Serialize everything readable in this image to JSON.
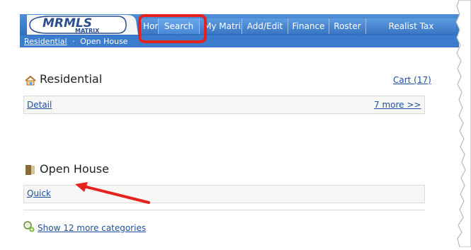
{
  "header": {
    "logo_text": "MRMLS",
    "logo_subtext": "MATRIX",
    "tabs": [
      {
        "label": "Home"
      },
      {
        "label": "Search"
      },
      {
        "label": "My Matrix"
      },
      {
        "label": "Add/Edit"
      },
      {
        "label": "Finance"
      },
      {
        "label": "Roster"
      },
      {
        "label": "Realist Tax"
      }
    ],
    "active_tab": "Search"
  },
  "breadcrumb": {
    "link": "Residential",
    "separator": "·",
    "current": "Open House"
  },
  "residential": {
    "title": "Residential",
    "icon": "house-icon",
    "cart_link": "Cart (17)",
    "detail_link": "Detail",
    "more_link": "7 more >>"
  },
  "open_house": {
    "title": "Open House",
    "icon": "open-house-icon",
    "quick_link": "Quick"
  },
  "footer": {
    "show_more_link": "Show 12 more categories",
    "icon": "magnifier-plus-icon"
  },
  "colors": {
    "header_blue": "#3c7ccc",
    "highlight_red": "#e5221e",
    "link_blue": "#1f4f9e"
  }
}
